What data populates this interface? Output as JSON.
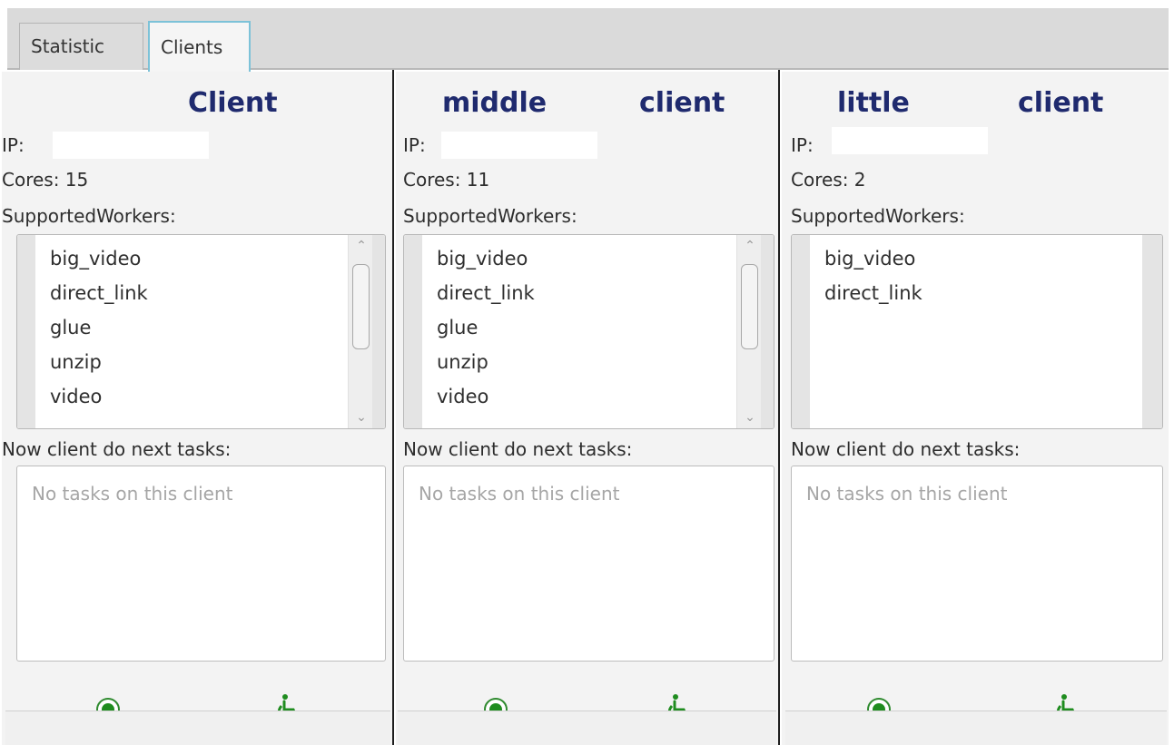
{
  "tabs": [
    {
      "label": "Statistic",
      "active": false
    },
    {
      "label": "Clients",
      "active": true
    }
  ],
  "clients": [
    {
      "title": "Client",
      "ip_label": "IP:",
      "cores_label": "Cores: 15",
      "workers_label": "SupportedWorkers:",
      "workers": [
        "big_video",
        "direct_link",
        "glue",
        "unzip",
        "video"
      ],
      "tasks_label": "Now client do next tasks:",
      "tasks_placeholder": "No tasks on this client",
      "status_icon": "green-radio-icon",
      "accessibility_icon": "wheelchair-icon"
    },
    {
      "title_left": "middle",
      "title_right": "client",
      "ip_label": "IP:",
      "cores_label": "Cores: 11",
      "workers_label": "SupportedWorkers:",
      "workers": [
        "big_video",
        "direct_link",
        "glue",
        "unzip",
        "video"
      ],
      "tasks_label": "Now client do next tasks:",
      "tasks_placeholder": "No tasks on this client",
      "status_icon": "green-radio-icon",
      "accessibility_icon": "wheelchair-icon"
    },
    {
      "title_left": "little",
      "title_right": "client",
      "ip_label": "IP:",
      "cores_label": "Cores: 2",
      "workers_label": "SupportedWorkers:",
      "workers": [
        "big_video",
        "direct_link"
      ],
      "tasks_label": "Now client do next tasks:",
      "tasks_placeholder": "No tasks on this client",
      "status_icon": "green-radio-icon",
      "accessibility_icon": "wheelchair-icon"
    }
  ],
  "colors": {
    "title": "#1f2a6e",
    "status_green": "#1f8c1f",
    "tab_active_border": "#7cc2d8"
  }
}
